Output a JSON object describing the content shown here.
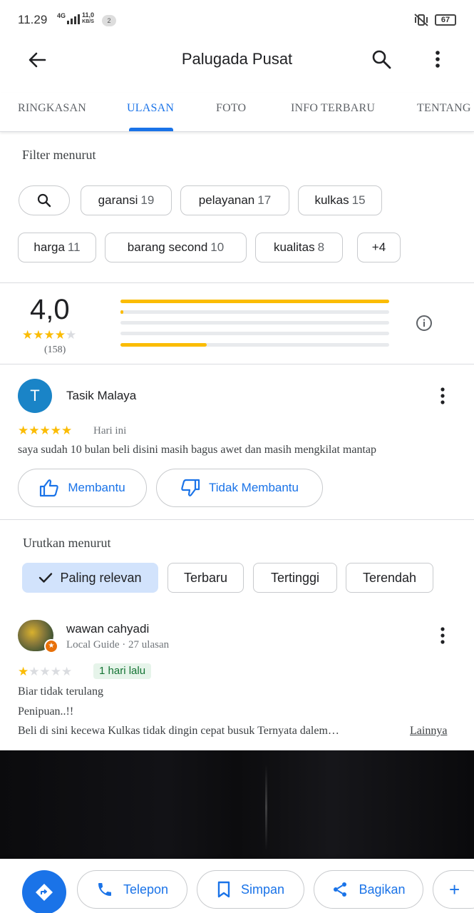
{
  "status_bar": {
    "time": "11.29",
    "network": "4G",
    "speed_value": "11,0",
    "speed_unit": "KB/S",
    "notification_count": "2",
    "battery": "67"
  },
  "appbar": {
    "title": "Palugada Pusat"
  },
  "tabs": [
    {
      "label": "RINGKASAN"
    },
    {
      "label": "ULASAN"
    },
    {
      "label": "FOTO"
    },
    {
      "label": "INFO TERBARU"
    },
    {
      "label": "TENTANG"
    }
  ],
  "filter": {
    "label": "Filter menurut",
    "chips": [
      {
        "label": "garansi",
        "count": "19"
      },
      {
        "label": "pelayanan",
        "count": "17"
      },
      {
        "label": "kulkas",
        "count": "15"
      },
      {
        "label": "harga",
        "count": "11"
      },
      {
        "label": "barang second",
        "count": "10"
      },
      {
        "label": "kualitas",
        "count": "8"
      },
      {
        "label": "+4",
        "count": ""
      }
    ]
  },
  "summary": {
    "rating": "4,0",
    "rating_value": 4,
    "review_count": "(158)",
    "distribution": [
      {
        "stars": 5,
        "fraction": 1.0
      },
      {
        "stars": 4,
        "fraction": 0.01
      },
      {
        "stars": 3,
        "fraction": 0.0
      },
      {
        "stars": 2,
        "fraction": 0.0
      },
      {
        "stars": 1,
        "fraction": 0.32
      }
    ],
    "star_color": "#fbbc04"
  },
  "first_review": {
    "avatar_letter": "T",
    "avatar_color": "#1a84c7",
    "name": "Tasik Malaya",
    "stars": 5,
    "date": "Hari ini",
    "text": "saya sudah 10 bulan beli disini masih bagus awet dan masih mengkilat mantap",
    "helpful_label": "Membantu",
    "not_helpful_label": "Tidak Membantu"
  },
  "sort": {
    "label": "Urutkan menurut",
    "options": [
      {
        "label": "Paling relevan",
        "selected": true
      },
      {
        "label": "Terbaru",
        "selected": false
      },
      {
        "label": "Tertinggi",
        "selected": false
      },
      {
        "label": "Terendah",
        "selected": false
      }
    ]
  },
  "second_review": {
    "name": "wawan cahyadi",
    "meta": "Local Guide · 27 ulasan",
    "stars": 1,
    "date_badge": "1 hari lalu",
    "lines": [
      "Biar tidak terulang",
      "Penipuan..!!",
      "Beli di sini kecewa Kulkas tidak dingin cepat busuk Ternyata dalem…"
    ],
    "more_label": "Lainnya"
  },
  "actions": {
    "directions_icon": "directions-icon",
    "call_label": "Telepon",
    "save_label": "Simpan",
    "share_label": "Bagikan",
    "add_label": "+"
  },
  "accent_color": "#1a73e8"
}
